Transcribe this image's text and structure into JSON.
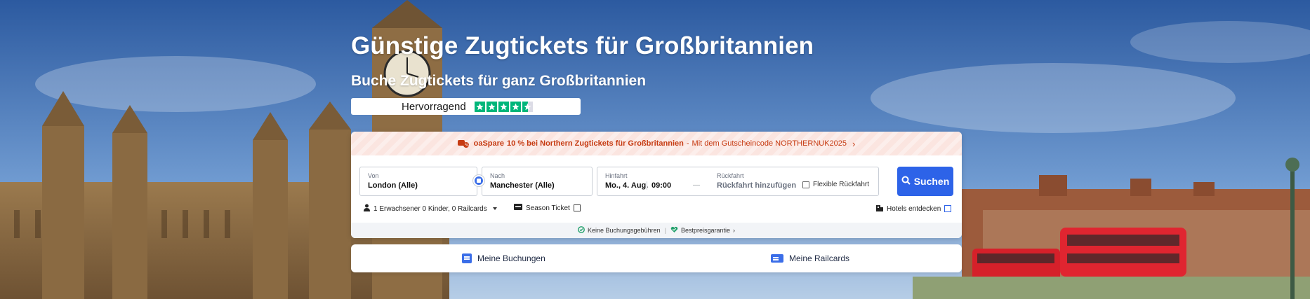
{
  "header": {
    "title": "Günstige Zugtickets für Großbritannien",
    "subtitle": "Buche Zugtickets für ganz Großbritannien",
    "rating_label": "Hervorragend",
    "rating_stars": 4.5
  },
  "promo": {
    "brand": "oaSpare",
    "headline": "10 % bei Northern Zugtickets für Großbritannien",
    "separator": "-",
    "detail": "Mit dem Gutscheincode NORTHERNUK2025",
    "chevron": "›",
    "color": "#c63b12"
  },
  "search": {
    "from_label": "Von",
    "from_value": "London (Alle)",
    "to_label": "Nach",
    "to_value": "Manchester (Alle)",
    "outbound_label": "Hinfahrt",
    "outbound_date": "Mo., 4. Aug.",
    "outbound_time": "09:00",
    "date_dash": "—",
    "return_label": "Rückfahrt",
    "return_placeholder": "Rückfahrt hinzufügen",
    "flexible_label": "Flexible Rückfahrt",
    "search_button": "Suchen",
    "button_color": "#2d63e8"
  },
  "options": {
    "passengers": "1 Erwachsener 0 Kinder, 0 Railcards",
    "season_ticket": "Season Ticket",
    "hotels": "Hotels entdecken"
  },
  "guarantees": {
    "no_fees": "Keine Buchungsgebühren",
    "separator": "|",
    "best_price": "Bestpreisgarantie",
    "chevron": "›"
  },
  "links": {
    "bookings": "Meine Buchungen",
    "railcards": "Meine Railcards"
  },
  "icons": [
    "person-icon",
    "ticket-icon",
    "hotel-icon",
    "search-icon",
    "swap-icon",
    "shield-check-icon",
    "heart-check-icon",
    "bookings-icon",
    "railcard-icon",
    "train-percent-icon"
  ]
}
